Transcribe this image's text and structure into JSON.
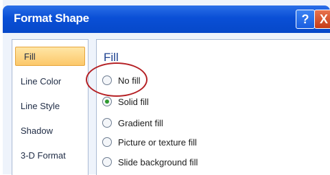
{
  "window": {
    "title": "Format Shape",
    "help_label": "?",
    "close_label": "X"
  },
  "sidebar": {
    "items": [
      {
        "label": "Fill",
        "selected": true
      },
      {
        "label": "Line Color",
        "selected": false
      },
      {
        "label": "Line Style",
        "selected": false
      },
      {
        "label": "Shadow",
        "selected": false
      },
      {
        "label": "3-D Format",
        "selected": false
      }
    ]
  },
  "main": {
    "section_title": "Fill",
    "options": [
      {
        "label": "No fill",
        "checked": false
      },
      {
        "label": "Solid fill",
        "checked": true
      },
      {
        "label": "Gradient fill",
        "checked": false
      },
      {
        "label": "Picture or texture fill",
        "checked": false
      },
      {
        "label": "Slide background fill",
        "checked": false
      }
    ]
  },
  "colors": {
    "titlebar": "#0a4fd6",
    "selected_item": "#fcc86a",
    "highlight_ring": "#b52024",
    "radio_checked": "#2f9a2f"
  }
}
